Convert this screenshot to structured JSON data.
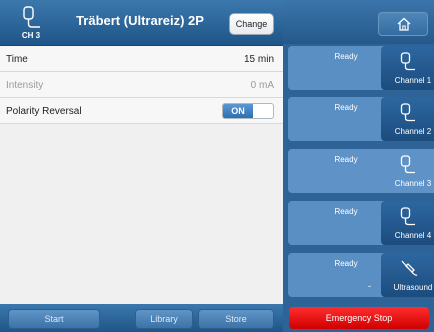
{
  "header": {
    "channel_label": "CH 3",
    "program_title": "Träbert (Ultrareiz) 2P",
    "change_label": "Change"
  },
  "params": [
    {
      "label": "Time",
      "value": "15 min"
    },
    {
      "label": "Intensity",
      "value": "0 mA"
    },
    {
      "label": "Polarity Reversal",
      "toggle": "ON"
    }
  ],
  "footer": {
    "start_label": "Start",
    "library_label": "Library",
    "store_label": "Store"
  },
  "channels": [
    {
      "status": "Ready",
      "name": "Channel 1",
      "icon": "electrode-icon"
    },
    {
      "status": "Ready",
      "name": "Channel 2",
      "icon": "electrode-icon"
    },
    {
      "status": "Ready",
      "name": "Channel 3",
      "icon": "electrode-icon"
    },
    {
      "status": "Ready",
      "name": "Channel 4",
      "icon": "electrode-icon"
    },
    {
      "status": "Ready",
      "extra": "-",
      "name": "Ultrasound",
      "icon": "ultrasound-head-icon"
    }
  ],
  "emergency_label": "Emergency Stop",
  "colors": {
    "header_blue": "#2b649a",
    "active_blue": "#2e6fb1",
    "emergency_red": "#ff0000"
  }
}
